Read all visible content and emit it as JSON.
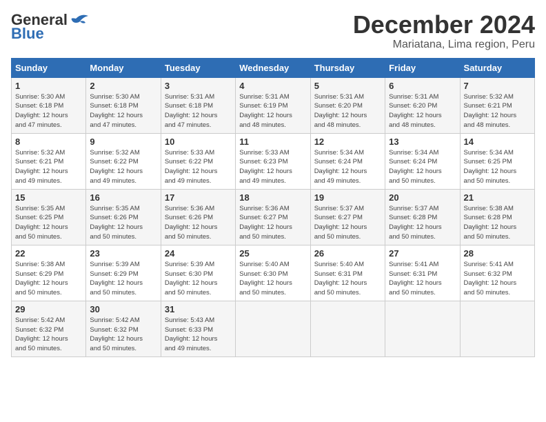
{
  "logo": {
    "line1": "General",
    "line2": "Blue"
  },
  "title": {
    "month": "December 2024",
    "location": "Mariatana, Lima region, Peru"
  },
  "weekdays": [
    "Sunday",
    "Monday",
    "Tuesday",
    "Wednesday",
    "Thursday",
    "Friday",
    "Saturday"
  ],
  "weeks": [
    [
      {
        "day": "1",
        "info": "Sunrise: 5:30 AM\nSunset: 6:18 PM\nDaylight: 12 hours\nand 47 minutes."
      },
      {
        "day": "2",
        "info": "Sunrise: 5:30 AM\nSunset: 6:18 PM\nDaylight: 12 hours\nand 47 minutes."
      },
      {
        "day": "3",
        "info": "Sunrise: 5:31 AM\nSunset: 6:18 PM\nDaylight: 12 hours\nand 47 minutes."
      },
      {
        "day": "4",
        "info": "Sunrise: 5:31 AM\nSunset: 6:19 PM\nDaylight: 12 hours\nand 48 minutes."
      },
      {
        "day": "5",
        "info": "Sunrise: 5:31 AM\nSunset: 6:20 PM\nDaylight: 12 hours\nand 48 minutes."
      },
      {
        "day": "6",
        "info": "Sunrise: 5:31 AM\nSunset: 6:20 PM\nDaylight: 12 hours\nand 48 minutes."
      },
      {
        "day": "7",
        "info": "Sunrise: 5:32 AM\nSunset: 6:21 PM\nDaylight: 12 hours\nand 48 minutes."
      }
    ],
    [
      {
        "day": "8",
        "info": "Sunrise: 5:32 AM\nSunset: 6:21 PM\nDaylight: 12 hours\nand 49 minutes."
      },
      {
        "day": "9",
        "info": "Sunrise: 5:32 AM\nSunset: 6:22 PM\nDaylight: 12 hours\nand 49 minutes."
      },
      {
        "day": "10",
        "info": "Sunrise: 5:33 AM\nSunset: 6:22 PM\nDaylight: 12 hours\nand 49 minutes."
      },
      {
        "day": "11",
        "info": "Sunrise: 5:33 AM\nSunset: 6:23 PM\nDaylight: 12 hours\nand 49 minutes."
      },
      {
        "day": "12",
        "info": "Sunrise: 5:34 AM\nSunset: 6:24 PM\nDaylight: 12 hours\nand 49 minutes."
      },
      {
        "day": "13",
        "info": "Sunrise: 5:34 AM\nSunset: 6:24 PM\nDaylight: 12 hours\nand 50 minutes."
      },
      {
        "day": "14",
        "info": "Sunrise: 5:34 AM\nSunset: 6:25 PM\nDaylight: 12 hours\nand 50 minutes."
      }
    ],
    [
      {
        "day": "15",
        "info": "Sunrise: 5:35 AM\nSunset: 6:25 PM\nDaylight: 12 hours\nand 50 minutes."
      },
      {
        "day": "16",
        "info": "Sunrise: 5:35 AM\nSunset: 6:26 PM\nDaylight: 12 hours\nand 50 minutes."
      },
      {
        "day": "17",
        "info": "Sunrise: 5:36 AM\nSunset: 6:26 PM\nDaylight: 12 hours\nand 50 minutes."
      },
      {
        "day": "18",
        "info": "Sunrise: 5:36 AM\nSunset: 6:27 PM\nDaylight: 12 hours\nand 50 minutes."
      },
      {
        "day": "19",
        "info": "Sunrise: 5:37 AM\nSunset: 6:27 PM\nDaylight: 12 hours\nand 50 minutes."
      },
      {
        "day": "20",
        "info": "Sunrise: 5:37 AM\nSunset: 6:28 PM\nDaylight: 12 hours\nand 50 minutes."
      },
      {
        "day": "21",
        "info": "Sunrise: 5:38 AM\nSunset: 6:28 PM\nDaylight: 12 hours\nand 50 minutes."
      }
    ],
    [
      {
        "day": "22",
        "info": "Sunrise: 5:38 AM\nSunset: 6:29 PM\nDaylight: 12 hours\nand 50 minutes."
      },
      {
        "day": "23",
        "info": "Sunrise: 5:39 AM\nSunset: 6:29 PM\nDaylight: 12 hours\nand 50 minutes."
      },
      {
        "day": "24",
        "info": "Sunrise: 5:39 AM\nSunset: 6:30 PM\nDaylight: 12 hours\nand 50 minutes."
      },
      {
        "day": "25",
        "info": "Sunrise: 5:40 AM\nSunset: 6:30 PM\nDaylight: 12 hours\nand 50 minutes."
      },
      {
        "day": "26",
        "info": "Sunrise: 5:40 AM\nSunset: 6:31 PM\nDaylight: 12 hours\nand 50 minutes."
      },
      {
        "day": "27",
        "info": "Sunrise: 5:41 AM\nSunset: 6:31 PM\nDaylight: 12 hours\nand 50 minutes."
      },
      {
        "day": "28",
        "info": "Sunrise: 5:41 AM\nSunset: 6:32 PM\nDaylight: 12 hours\nand 50 minutes."
      }
    ],
    [
      {
        "day": "29",
        "info": "Sunrise: 5:42 AM\nSunset: 6:32 PM\nDaylight: 12 hours\nand 50 minutes."
      },
      {
        "day": "30",
        "info": "Sunrise: 5:42 AM\nSunset: 6:32 PM\nDaylight: 12 hours\nand 50 minutes."
      },
      {
        "day": "31",
        "info": "Sunrise: 5:43 AM\nSunset: 6:33 PM\nDaylight: 12 hours\nand 49 minutes."
      },
      null,
      null,
      null,
      null
    ]
  ]
}
